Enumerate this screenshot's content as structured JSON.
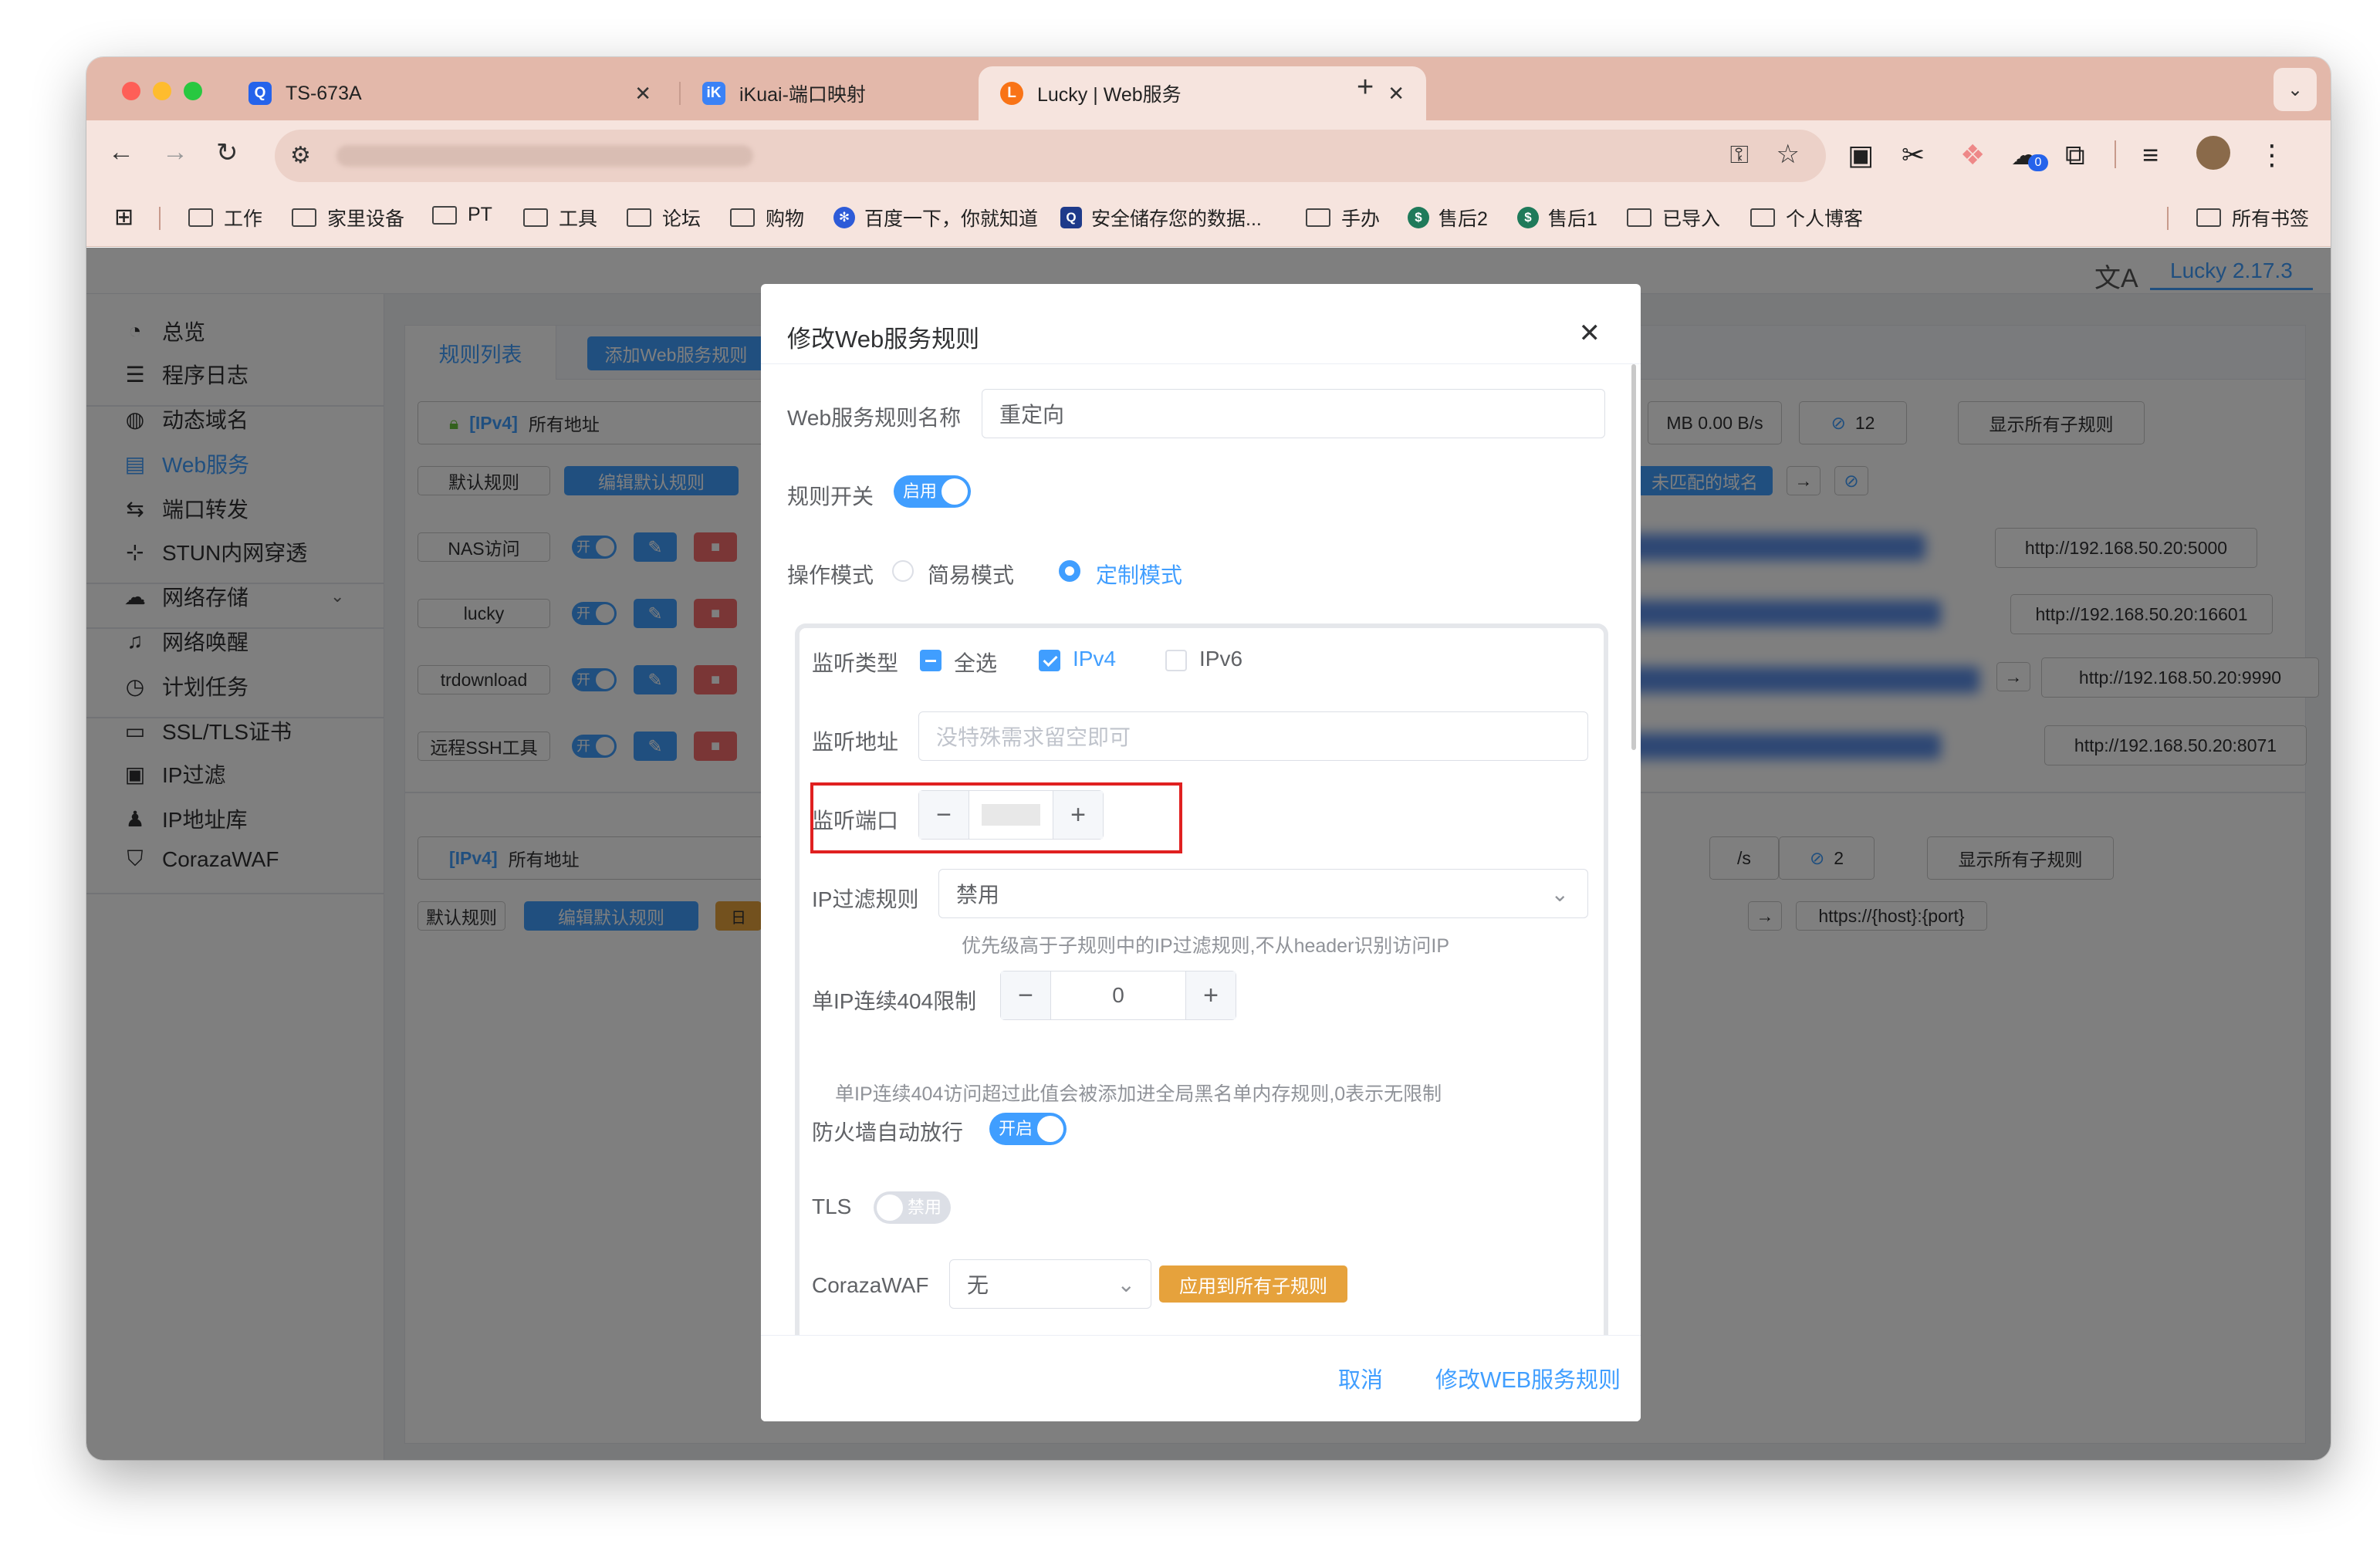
{
  "browser": {
    "tabs": [
      {
        "title": "TS-673A",
        "icon": "Q",
        "color": "#2563eb"
      },
      {
        "title": "iKuai-端口映射",
        "icon": "iK",
        "color": "#3b82f6"
      },
      {
        "title": "Lucky | Web服务",
        "icon": "L",
        "color": "#f97316"
      }
    ],
    "bookmarks": [
      "工作",
      "家里设备",
      "PT",
      "工具",
      "论坛",
      "购物",
      "百度一下，你就知道",
      "安全储存您的数据...",
      "手办",
      "售后2",
      "售后1",
      "已导入",
      "个人博客"
    ],
    "all_bookmarks": "所有书签",
    "extension_badge": "0"
  },
  "app": {
    "version": "Lucky 2.17.3",
    "nav": [
      "总览",
      "程序日志",
      "动态域名",
      "Web服务",
      "端口转发",
      "STUN内网穿透",
      "网络存储",
      "网络唤醒",
      "计划任务",
      "SSL/TLS证书",
      "IP过滤",
      "IP地址库",
      "CorazaWAF"
    ],
    "tabs": {
      "list": "规则列表",
      "add": "添加Web服务规则"
    },
    "group1": {
      "proto": "[IPv4]",
      "addr": "所有地址",
      "traffic": "MB 0.00 B/s",
      "count": "12",
      "show_all": "显示所有子规则",
      "default_rule": "默认规则",
      "edit_default": "编辑默认规则",
      "unmatched": "未匹配的域名"
    },
    "rules": [
      {
        "name": "NAS访问",
        "toggle": "开",
        "target": "http://192.168.50.20:5000"
      },
      {
        "name": "lucky",
        "toggle": "开",
        "target": "http://192.168.50.20:16601"
      },
      {
        "name": "trdownload",
        "toggle": "开",
        "target": "http://192.168.50.20:9990"
      },
      {
        "name": "远程SSH工具",
        "toggle": "开",
        "target": "http://192.168.50.20:8071"
      }
    ],
    "group2": {
      "proto": "[IPv4]",
      "addr": "所有地址",
      "traffic": "/s",
      "count": "2",
      "show_all": "显示所有子规则",
      "default_rule": "默认规则",
      "edit_default": "编辑默认规则",
      "eye_label": "日",
      "target": "https://{host}:{port}"
    }
  },
  "modal": {
    "title": "修改Web服务规则",
    "name_label": "Web服务规则名称",
    "name_value": "重定向",
    "switch_label": "规则开关",
    "switch_state": "启用",
    "mode_label": "操作模式",
    "mode_simple": "简易模式",
    "mode_custom": "定制模式",
    "listen_type_label": "监听类型",
    "listen_all": "全选",
    "listen_ipv4": "IPv4",
    "listen_ipv6": "IPv6",
    "listen_addr_label": "监听地址",
    "listen_addr_placeholder": "没特殊需求留空即可",
    "listen_port_label": "监听端口",
    "ipfilter_label": "IP过滤规则",
    "ipfilter_value": "禁用",
    "ipfilter_hint": "优先级高于子规则中的IP过滤规则,不从header识别访问IP",
    "limit404_label": "单IP连续404限制",
    "limit404_value": "0",
    "limit404_hint": "单IP连续404访问超过此值会被添加进全局黑名单内存规则,0表示无限制",
    "firewall_label": "防火墙自动放行",
    "firewall_state": "开启",
    "tls_label": "TLS",
    "tls_state": "禁用",
    "waf_label": "CorazaWAF",
    "waf_value": "无",
    "waf_apply": "应用到所有子规则",
    "cancel": "取消",
    "submit": "修改WEB服务规则"
  }
}
